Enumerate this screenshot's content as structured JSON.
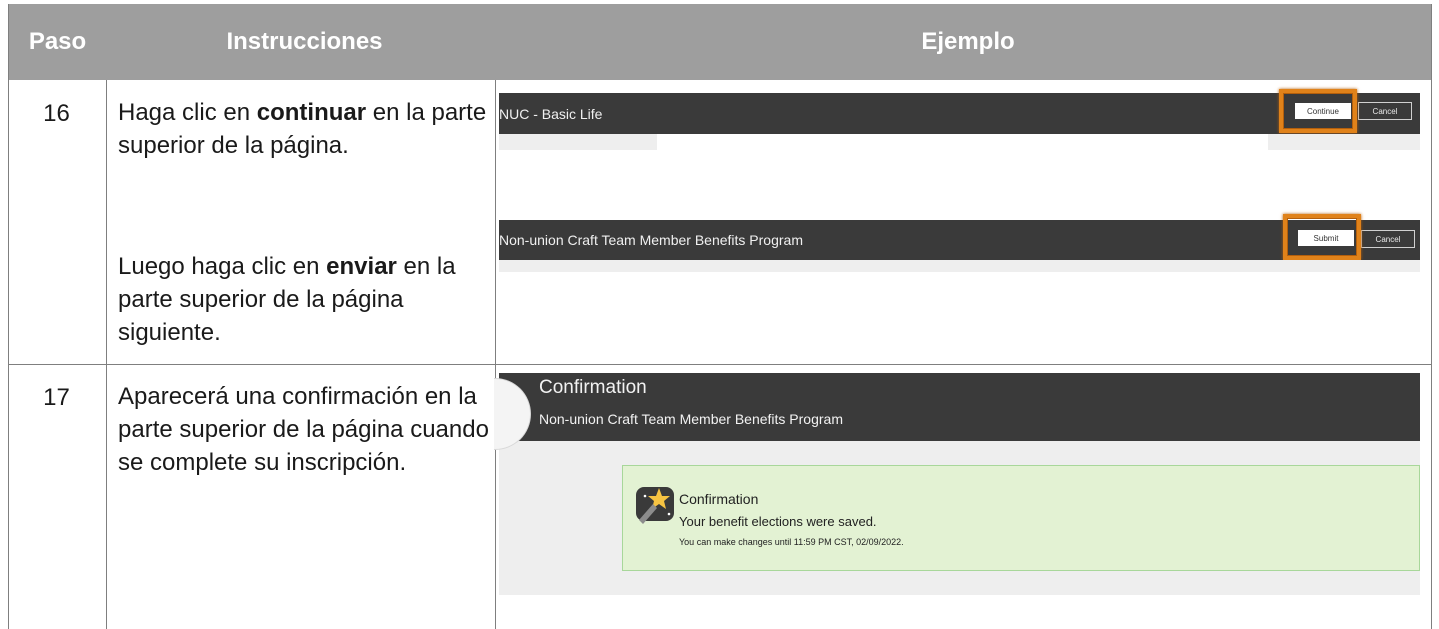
{
  "headers": {
    "step": "Paso",
    "instructions": "Instrucciones",
    "example": "Ejemplo"
  },
  "rows": [
    {
      "step": "16",
      "text_a_pre": "Haga clic en ",
      "text_a_bold": "continuar",
      "text_a_post": " en la parte superior de la página.",
      "text_b_pre": "Luego haga clic en ",
      "text_b_bold": "enviar",
      "text_b_post": " en la parte superior de la página siguiente."
    },
    {
      "step": "17",
      "text": "Aparecerá una confirmación en la parte superior de la página cuando se complete su inscripción."
    }
  ],
  "examples": {
    "shot1": {
      "title": "NUC - Basic Life",
      "continue": "Continue",
      "cancel": "Cancel"
    },
    "shot2": {
      "title": "Non-union Craft Team Member Benefits Program",
      "submit": "Submit",
      "cancel": "Cancel"
    },
    "shot3": {
      "heading": "Confirmation",
      "program": "Non-union Craft Team Member Benefits Program",
      "box_title": "Confirmation",
      "box_message": "Your benefit elections were saved.",
      "box_note": "You can make changes until 11:59 PM CST, 02/09/2022."
    }
  },
  "colors": {
    "header_bg": "#9e9e9e",
    "highlight": "#e0821a",
    "dark_bar": "#3a3a3a",
    "success_bg": "#e3f2d3"
  }
}
